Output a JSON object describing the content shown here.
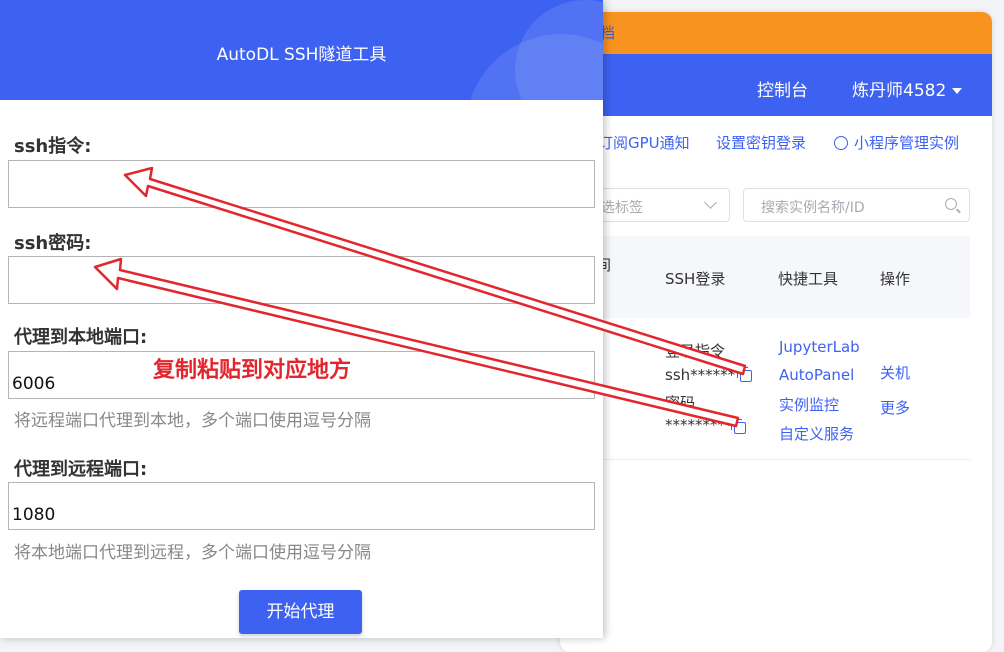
{
  "background": {
    "orange_text": "档",
    "nav": {
      "console": "控制台",
      "user": "炼丹师4582"
    },
    "links": {
      "subscribe": "订阅GPU通知",
      "key_login": "设置密钥登录",
      "mini_program": "小程序管理实例"
    },
    "filter": {
      "tag_placeholder": "选标签",
      "search_placeholder": "搜索实例名称/ID"
    },
    "table": {
      "headers": {
        "time": "间",
        "ssh": "SSH登录",
        "tools": "快捷工具",
        "actions": "操作"
      },
      "row": {
        "ssh_cmd_label": "登录指令",
        "ssh_cmd_value": "ssh******",
        "password_label": "密码",
        "password_value": "*********",
        "tools": [
          "JupyterLab",
          "AutoPanel",
          "实例监控",
          "自定义服务"
        ],
        "actions": [
          "关机",
          "更多"
        ]
      }
    },
    "colors": {
      "orange": "#f7931e",
      "brand": "#3d62f2"
    }
  },
  "dialog": {
    "title": "AutoDL SSH隧道工具",
    "ssh_cmd": {
      "label": "ssh指令:",
      "value": ""
    },
    "ssh_password": {
      "label": "ssh密码:",
      "value": ""
    },
    "local_port": {
      "label": "代理到本地端口:",
      "value": "6006",
      "help": "将远程端口代理到本地，多个端口使用逗号分隔"
    },
    "remote_port": {
      "label": "代理到远程端口:",
      "value": "1080",
      "help": "将本地端口代理到远程，多个端口使用逗号分隔"
    },
    "start_button": "开始代理"
  },
  "annotation": {
    "text": "复制粘贴到对应地方",
    "color": "#e3262e"
  }
}
